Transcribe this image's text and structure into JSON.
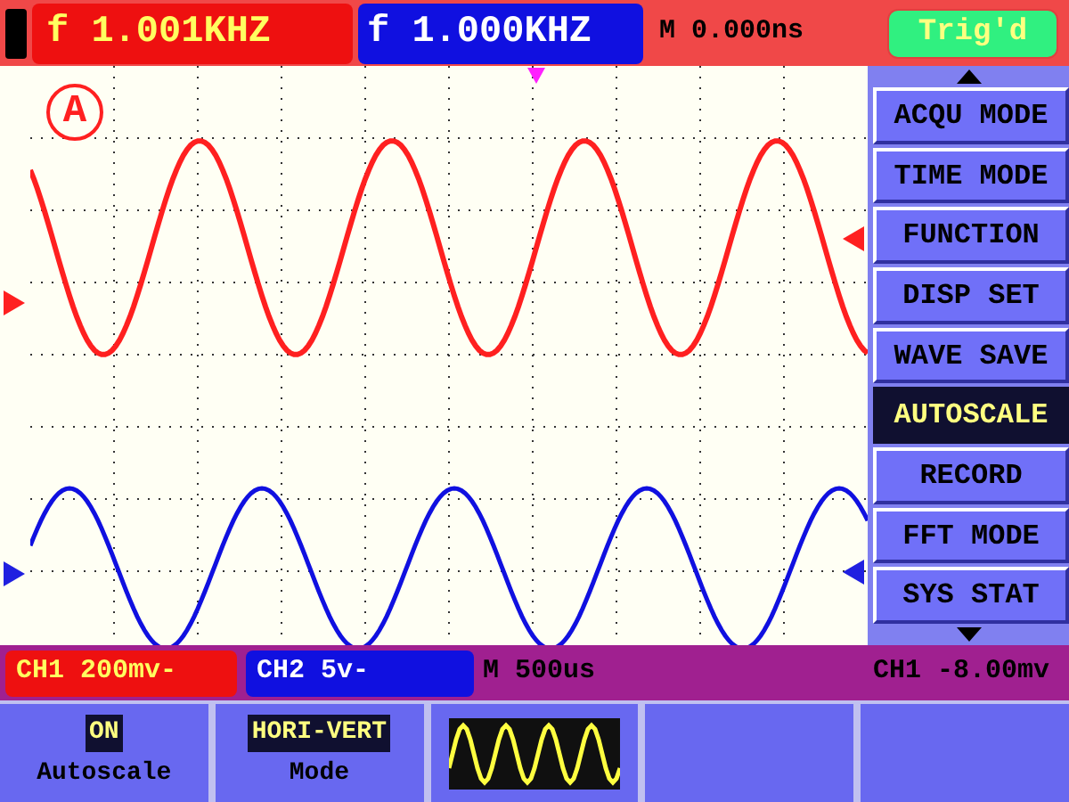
{
  "header": {
    "freq_ch1": "f 1.001KHZ",
    "freq_ch2": "f 1.000KHZ",
    "time_offset": "M 0.000ns",
    "trigger_status": "Trig'd"
  },
  "plot": {
    "mode_badge": "A"
  },
  "menu": {
    "items": [
      {
        "label": "ACQU MODE",
        "selected": false
      },
      {
        "label": "TIME MODE",
        "selected": false
      },
      {
        "label": "FUNCTION",
        "selected": false
      },
      {
        "label": "DISP SET",
        "selected": false
      },
      {
        "label": "WAVE SAVE",
        "selected": false
      },
      {
        "label": "AUTOSCALE",
        "selected": true
      },
      {
        "label": "RECORD",
        "selected": false
      },
      {
        "label": "FFT MODE",
        "selected": false
      },
      {
        "label": "SYS STAT",
        "selected": false
      }
    ]
  },
  "status_bar": {
    "ch1_scale": "CH1 200mv-",
    "ch2_scale": "CH2 5v-",
    "timebase": "M 500us",
    "trigger_level": "CH1 -8.00mv"
  },
  "softkeys": [
    {
      "kind": "text",
      "top": "ON",
      "bottom": "Autoscale"
    },
    {
      "kind": "text",
      "top": "HORI-VERT",
      "bottom": "Mode"
    },
    {
      "kind": "wave"
    },
    {
      "kind": "empty"
    },
    {
      "kind": "empty"
    }
  ]
}
